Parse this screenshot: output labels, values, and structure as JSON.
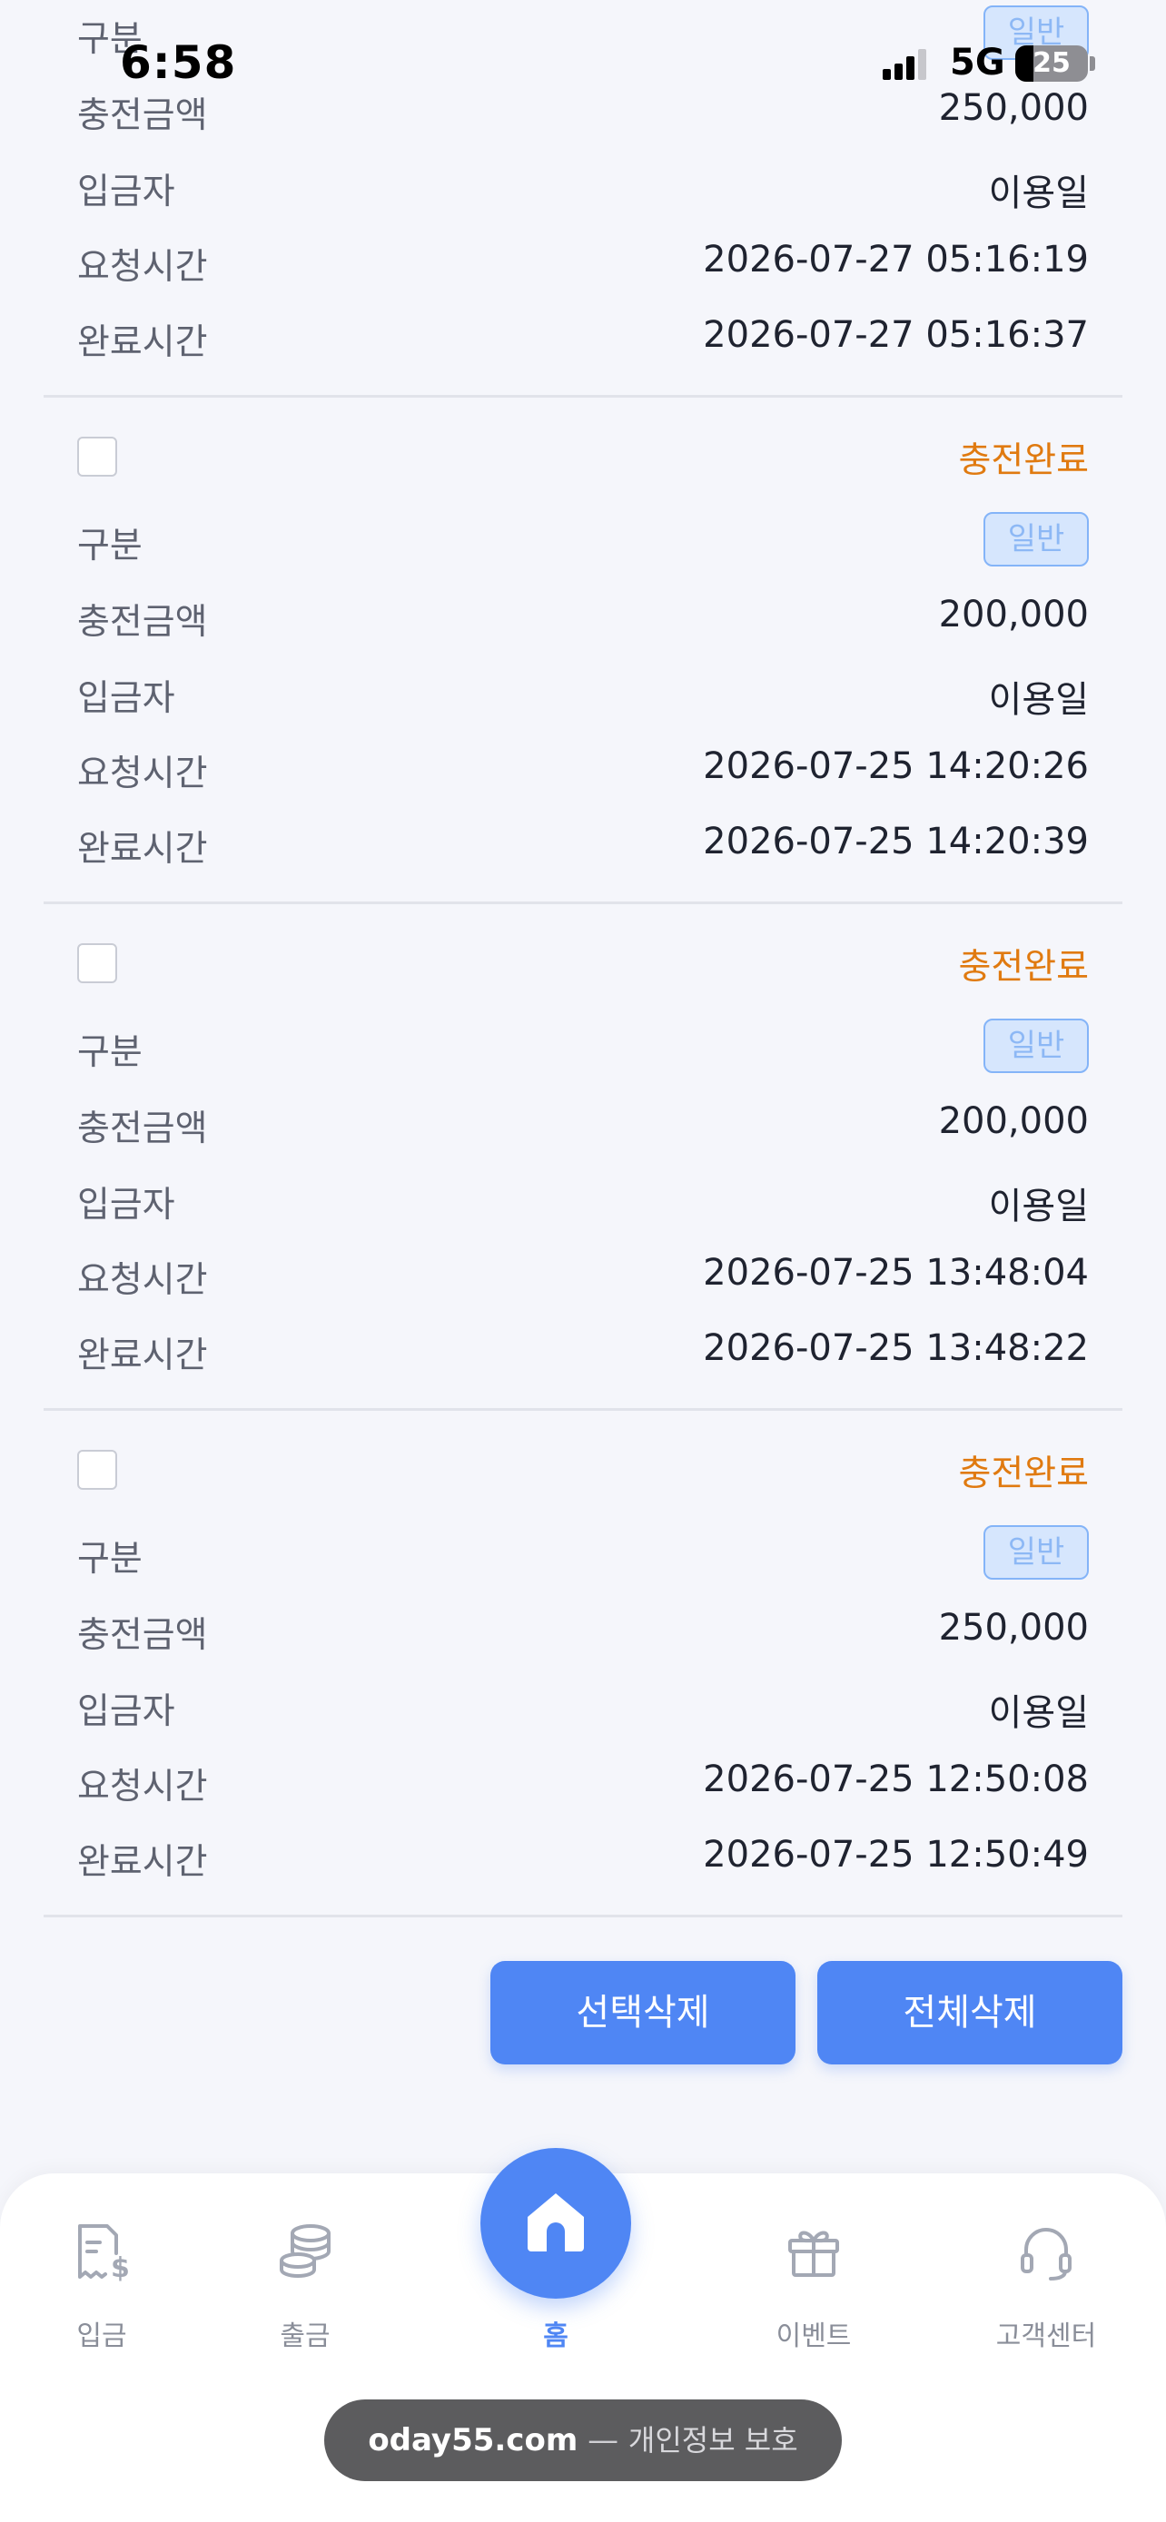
{
  "status_bar": {
    "time": "6:58",
    "network": "5G",
    "battery_level": "25",
    "battery_fraction": 0.25
  },
  "labels": {
    "type": "구분",
    "amount": "충전금액",
    "depositor": "입금자",
    "request_time": "요청시간",
    "complete_time": "완료시간"
  },
  "records": [
    {
      "status": "",
      "type": "일반",
      "amount": "250,000",
      "depositor": "이용일",
      "request_time": "2026-07-27 05:16:19",
      "complete_time": "2026-07-27 05:16:37"
    },
    {
      "status": "충전완료",
      "type": "일반",
      "amount": "200,000",
      "depositor": "이용일",
      "request_time": "2026-07-25 14:20:26",
      "complete_time": "2026-07-25 14:20:39"
    },
    {
      "status": "충전완료",
      "type": "일반",
      "amount": "200,000",
      "depositor": "이용일",
      "request_time": "2026-07-25 13:48:04",
      "complete_time": "2026-07-25 13:48:22"
    },
    {
      "status": "충전완료",
      "type": "일반",
      "amount": "250,000",
      "depositor": "이용일",
      "request_time": "2026-07-25 12:50:08",
      "complete_time": "2026-07-25 12:50:49"
    }
  ],
  "actions": {
    "delete_selected": "선택삭제",
    "delete_all": "전체삭제"
  },
  "nav": {
    "deposit": {
      "label": "입금",
      "icon": "receipt-dollar-icon"
    },
    "withdraw": {
      "label": "출금",
      "icon": "coins-icon"
    },
    "home": {
      "label": "홈",
      "icon": "home-icon"
    },
    "event": {
      "label": "이벤트",
      "icon": "gift-icon"
    },
    "support": {
      "label": "고객센터",
      "icon": "headset-icon"
    }
  },
  "browser": {
    "host": "oday55.com",
    "separator": "—",
    "description": "개인정보 보호"
  },
  "colors": {
    "accent": "#4f86f4",
    "status_complete": "#e07a10",
    "badge_bg": "#d6e6fd",
    "badge_text": "#8db8f5",
    "background": "#f5f6fb"
  }
}
